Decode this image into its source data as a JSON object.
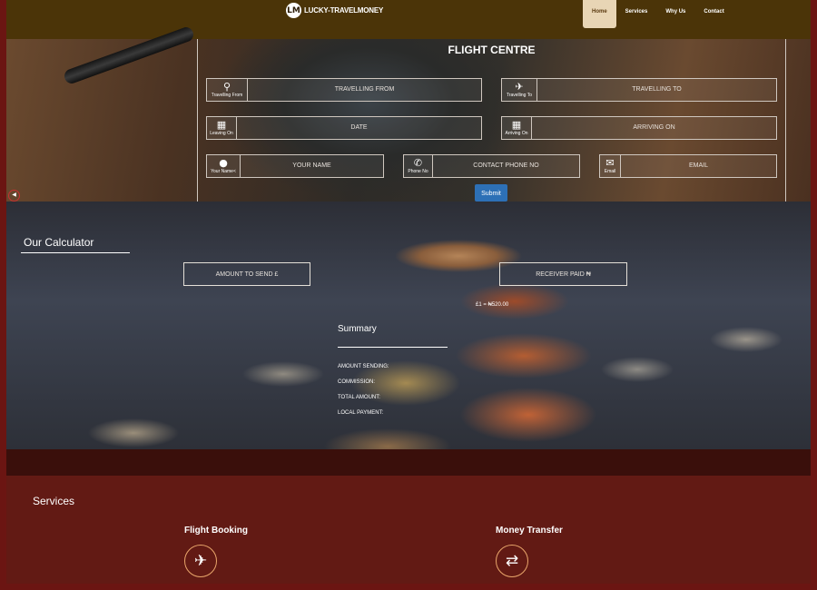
{
  "brand": {
    "badge": "LM",
    "name": "LUCKY-TRAVELMONEY"
  },
  "nav": {
    "items": [
      {
        "label": "Home",
        "active": true
      },
      {
        "label": "Services",
        "active": false
      },
      {
        "label": "Why Us",
        "active": false
      },
      {
        "label": "Contact",
        "active": false
      }
    ]
  },
  "flight": {
    "title": "FLIGHT CENTRE",
    "fields": {
      "from": {
        "label": "Travelling From",
        "placeholder": "TRAVELLING FROM",
        "icon": "map-marker-icon"
      },
      "to": {
        "label": "Travelling To",
        "placeholder": "TRAVELLING TO",
        "icon": "plane-icon"
      },
      "leaving": {
        "label": "Leaving On",
        "placeholder": "DATE",
        "icon": "calendar-icon"
      },
      "arriving": {
        "label": "Arriving On",
        "placeholder": "ARRIVING ON",
        "icon": "calendar-icon"
      },
      "name": {
        "label": "Your Name<",
        "placeholder": "YOUR NAME",
        "icon": "user-icon"
      },
      "phone": {
        "label": "Phone No",
        "placeholder": "CONTACT PHONE NO",
        "icon": "phone-icon"
      },
      "email": {
        "label": "Email",
        "placeholder": "EMAIL",
        "icon": "envelope-icon"
      }
    },
    "submit": "Submit"
  },
  "calculator": {
    "title": "Our Calculator",
    "send_placeholder": "AMOUNT TO SEND   £",
    "receive_placeholder": "RECEIVER PAID   ₦",
    "rate": "£1 = ₦520.00",
    "summary": {
      "title": "Summary",
      "rows": [
        "AMOUNT SENDING:",
        "COMMISSION:",
        "TOTAL AMOUNT:",
        "LOCAL PAYMENT:"
      ]
    }
  },
  "services": {
    "title": "Services",
    "items": [
      {
        "label": "Flight Booking",
        "icon": "plane-icon"
      },
      {
        "label": "Money Transfer",
        "icon": "exchange-icon"
      }
    ]
  },
  "colors": {
    "accent": "#2d70b6",
    "frame": "#6b1512",
    "nav_bg": "#4b3408",
    "services_bg": "#621a14"
  }
}
